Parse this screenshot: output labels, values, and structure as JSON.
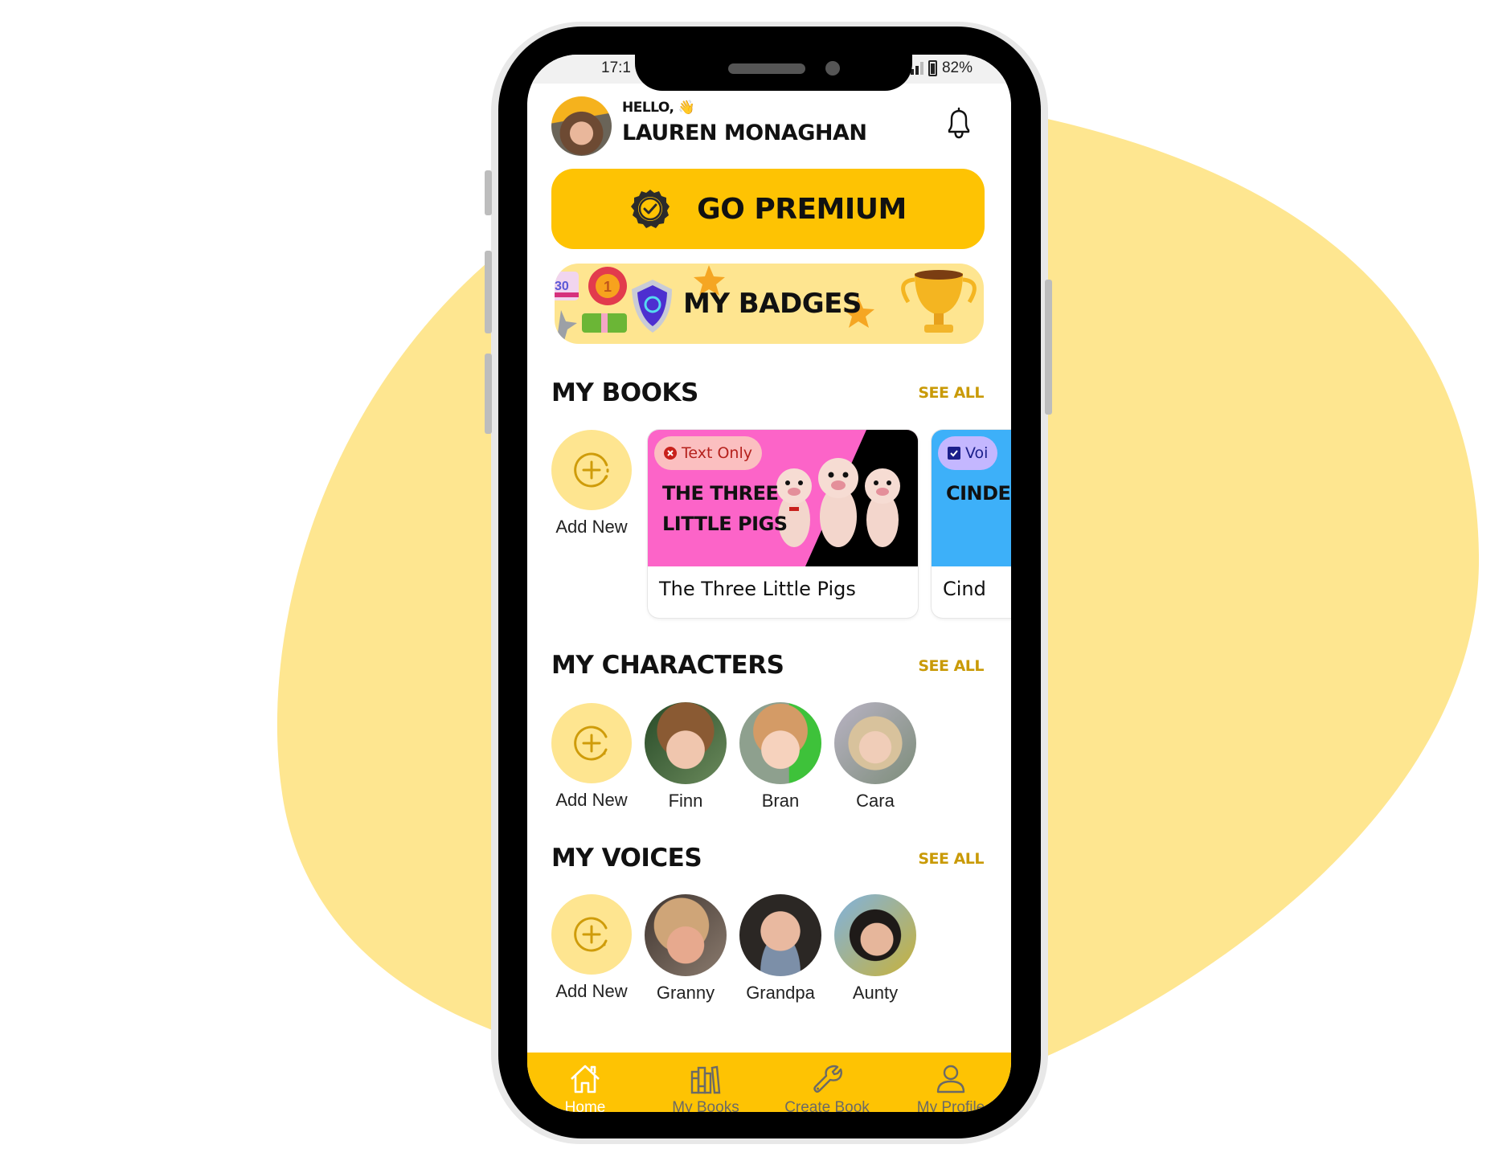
{
  "status_bar": {
    "time": "17:1",
    "battery": "82%"
  },
  "header": {
    "greeting": "Hello,",
    "wave_emoji": "👋",
    "user_name": "Lauren Monaghan"
  },
  "premium": {
    "label": "Go Premium",
    "icon": "verified-badge-icon"
  },
  "badges": {
    "label": "My Badges"
  },
  "sections": {
    "books": {
      "title": "My Books",
      "see_all": "See All",
      "add_label": "Add New",
      "items": [
        {
          "title": "The Three Little Pigs",
          "cover_title": [
            "The Three",
            "Little Pigs"
          ],
          "tag": "Text Only",
          "tag_icon": "x-circle-icon",
          "colors": {
            "bg": "#fc64c8",
            "accent": "#000000",
            "tag_bg": "#fbbfc0",
            "tag_fg": "#b5201c"
          }
        },
        {
          "title": "Cind",
          "cover_title": [
            "Cinderella"
          ],
          "tag": "Voi",
          "tag_icon": "checkbox-icon",
          "colors": {
            "bg": "#3db0f9",
            "tag_bg": "#c4b7ff",
            "tag_fg": "#1b1f8a"
          }
        }
      ]
    },
    "characters": {
      "title": "My Characters",
      "see_all": "See All",
      "add_label": "Add New",
      "items": [
        {
          "name": "Finn"
        },
        {
          "name": "Bran"
        },
        {
          "name": "Cara"
        }
      ]
    },
    "voices": {
      "title": "My Voices",
      "see_all": "See All",
      "add_label": "Add New",
      "items": [
        {
          "name": "Granny"
        },
        {
          "name": "Grandpa"
        },
        {
          "name": "Aunty"
        }
      ]
    }
  },
  "bottom_nav": {
    "items": [
      {
        "label": "Home",
        "icon": "home-icon",
        "active": true
      },
      {
        "label": "My Books",
        "icon": "books-icon",
        "active": false
      },
      {
        "label": "Create Book",
        "icon": "wrench-icon",
        "active": false
      },
      {
        "label": "My Profile",
        "icon": "profile-icon",
        "active": false
      }
    ]
  },
  "colors": {
    "brand_yellow": "#fec303",
    "light_yellow": "#fee590",
    "see_all": "#c99a06",
    "blob": "#fee690"
  }
}
